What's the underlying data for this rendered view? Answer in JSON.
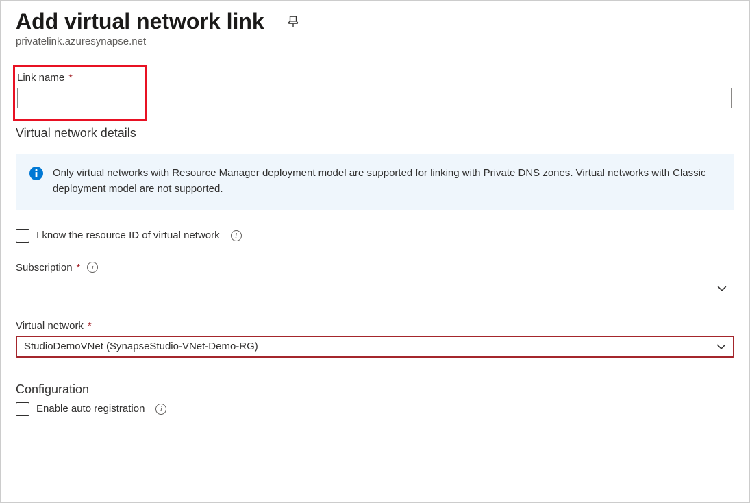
{
  "header": {
    "title": "Add virtual network link",
    "subtitle": "privatelink.azuresynapse.net"
  },
  "linkName": {
    "label": "Link name",
    "value": ""
  },
  "vnetDetails": {
    "section_title": "Virtual network details",
    "banner": "Only virtual networks with Resource Manager deployment model are supported for linking with Private DNS zones. Virtual networks with Classic deployment model are not supported.",
    "know_resource_id_label": "I know the resource ID of virtual network"
  },
  "subscription": {
    "label": "Subscription",
    "value": ""
  },
  "virtualNetwork": {
    "label": "Virtual network",
    "value": "StudioDemoVNet (SynapseStudio-VNet-Demo-RG)"
  },
  "configuration": {
    "section_title": "Configuration",
    "enable_auto_label": "Enable auto registration"
  }
}
